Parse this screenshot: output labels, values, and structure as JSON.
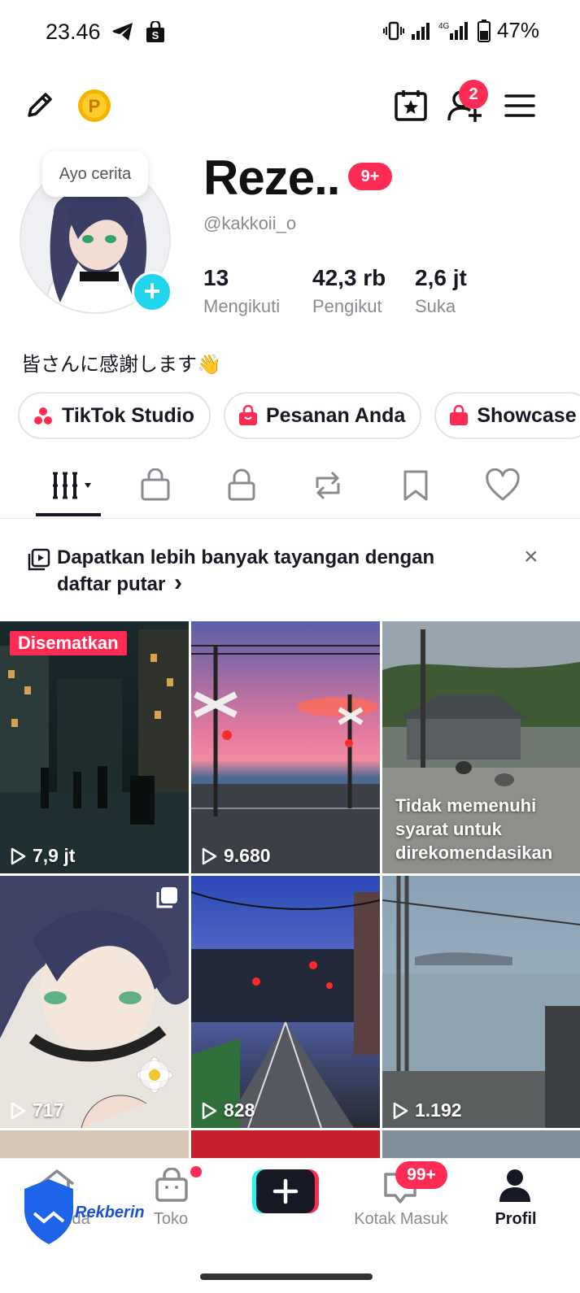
{
  "status_bar": {
    "time": "23.46",
    "battery": "47%",
    "network": "4G"
  },
  "profile": {
    "story_bubble": "Ayo cerita",
    "display_name": "Reze..",
    "name_badge": "9+",
    "username": "@kakkoii_o",
    "stats": [
      {
        "value": "13",
        "label": "Mengikuti"
      },
      {
        "value": "42,3 rb",
        "label": "Pengikut"
      },
      {
        "value": "2,6 jt",
        "label": "Suka"
      }
    ],
    "bio": "皆さんに感謝します👋"
  },
  "top_bar": {
    "friend_badge": "2"
  },
  "chips": [
    {
      "label": "TikTok Studio",
      "icon": "studio-icon"
    },
    {
      "label": "Pesanan Anda",
      "icon": "bag-icon"
    },
    {
      "label": "Showcase",
      "icon": "showcase-icon"
    }
  ],
  "tabs": [
    "videos",
    "shop",
    "private",
    "reposts",
    "favorites",
    "liked"
  ],
  "banner": {
    "text": "Dapatkan lebih banyak tayangan dengan daftar putar",
    "chevron": "›"
  },
  "videos": [
    {
      "views": "7,9 jt",
      "pinned_label": "Disematkan"
    },
    {
      "views": "9.680"
    },
    {
      "notice": "Tidak memenuhi syarat untuk direkomendasikan"
    },
    {
      "views": "717"
    },
    {
      "views": "828"
    },
    {
      "views": "1.192"
    }
  ],
  "bottom_nav": {
    "home": "Beranda",
    "shop": "Toko",
    "inbox": "Kotak Masuk",
    "inbox_badge": "99+",
    "profile": "Profil"
  },
  "watermark": "Rekberin",
  "colors": {
    "accent": "#fe2c55",
    "cyan": "#20d5ec",
    "text": "#161823",
    "muted": "#8a8b91"
  }
}
